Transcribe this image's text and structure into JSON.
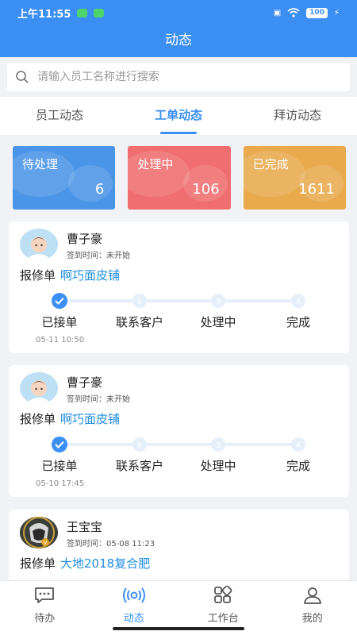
{
  "status_bar": {
    "time": "上午11:55",
    "battery": "100"
  },
  "header": {
    "title": "动态"
  },
  "search": {
    "placeholder": "请输入员工名称进行搜索"
  },
  "tabs": [
    {
      "label": "员工动态",
      "active": false
    },
    {
      "label": "工单动态",
      "active": true
    },
    {
      "label": "拜访动态",
      "active": false
    }
  ],
  "stats": [
    {
      "label": "待处理",
      "value": "6",
      "color": "#4a95e8"
    },
    {
      "label": "处理中",
      "value": "106",
      "color": "#f06e6f"
    },
    {
      "label": "已完成",
      "value": "1611",
      "color": "#e8aa4d"
    }
  ],
  "steps": [
    "已接单",
    "联系客户",
    "处理中",
    "完成"
  ],
  "cards": [
    {
      "name": "曹子豪",
      "signin": "签到时间：未开始",
      "order_type": "报修单",
      "shop": "啊巧面皮铺",
      "date": "05-11 10:50",
      "current_step": 1,
      "avatar": "cartoon-avatar"
    },
    {
      "name": "曹子豪",
      "signin": "签到时间：未开始",
      "order_type": "报修单",
      "shop": "啊巧面皮铺",
      "date": "05-10 17:45",
      "current_step": 1,
      "avatar": "cartoon-avatar"
    },
    {
      "name": "王宝宝",
      "signin": "签到时间：05-08 11:23",
      "order_type": "报修单",
      "shop": "大地2018复合肥",
      "avatar": "photo-avatar"
    }
  ],
  "bottom_nav": [
    {
      "label": "待办",
      "icon": "chat-icon",
      "active": false
    },
    {
      "label": "动态",
      "icon": "broadcast-icon",
      "active": true
    },
    {
      "label": "工作台",
      "icon": "grid-icon",
      "active": false
    },
    {
      "label": "我的",
      "icon": "user-icon",
      "active": false
    }
  ],
  "colors": {
    "primary": "#3b8ff3",
    "link": "#1f8de0"
  }
}
